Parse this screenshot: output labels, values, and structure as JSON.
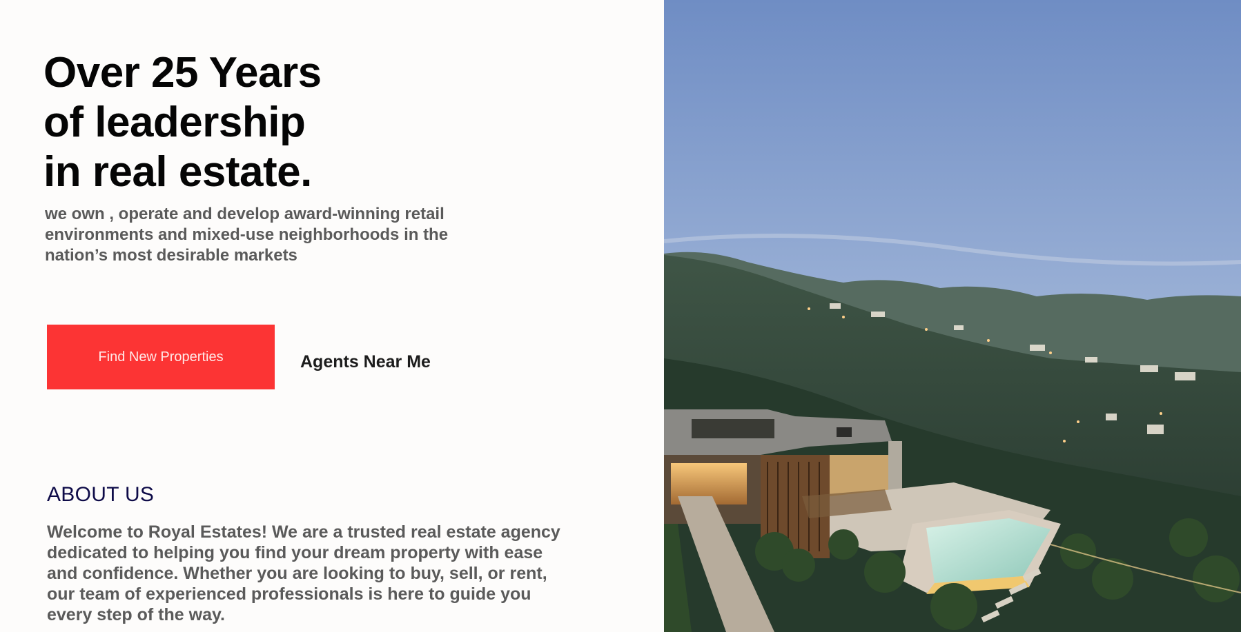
{
  "hero": {
    "headline": [
      "Over 25 Years",
      "of leadership",
      "in real estate."
    ],
    "subtitle": "we own , operate and develop award-winning retail environments and mixed-use neighborhoods in the nation’s most desirable markets",
    "primary_button": "Find New Properties",
    "secondary_button": "Agents Near Me"
  },
  "about": {
    "heading": "ABOUT US",
    "text": "Welcome to Royal Estates! We are a trusted real estate agency dedicated to helping you find your dream property with ease and confidence. Whether you are looking to buy, sell, or rent, our team of experienced professionals is here to guide you every step of the way."
  },
  "image": {
    "subject": "modern-hillside-villa-with-pool-at-dusk"
  },
  "colors": {
    "page_background": "#fdfcfb",
    "primary_button": "#fc3434",
    "about_heading": "#0e0b48",
    "body_text": "#5a5a5a"
  }
}
